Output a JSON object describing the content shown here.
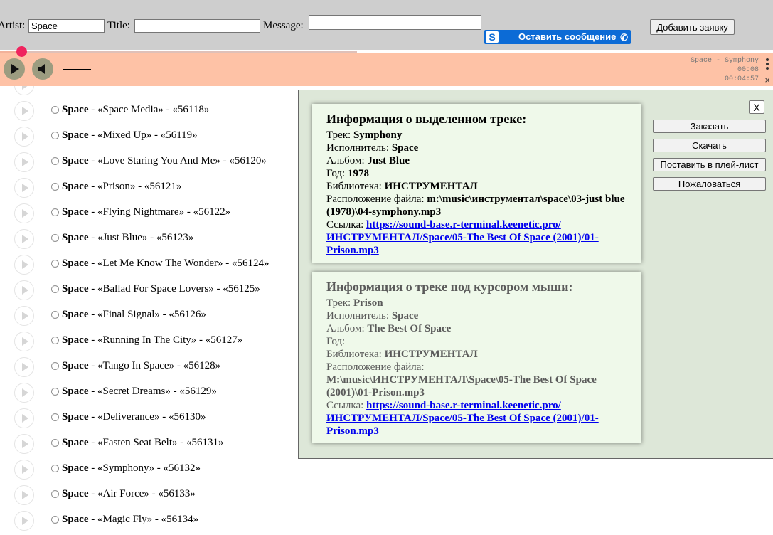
{
  "form": {
    "artist_label": "Artist:",
    "artist_value": "Space",
    "title_label": "Title:",
    "title_value": "",
    "message_label": "Message:",
    "message_value": "",
    "leave_message_label": "Оставить сообщение",
    "add_request_label": "Добавить заявку"
  },
  "player": {
    "progress_fraction": 0.06,
    "track_line": "Space - Symphony",
    "elapsed": "00:08",
    "duration": "00:04:57",
    "close_glyph": "×"
  },
  "tracks": [
    {
      "artist": "Space",
      "text": " - «Space Media» - «56118»"
    },
    {
      "artist": "Space",
      "text": " - «Mixed Up» - «56119»"
    },
    {
      "artist": "Space",
      "text": " - «Love Staring You And Me» - «56120»"
    },
    {
      "artist": "Space",
      "text": " - «Prison» - «56121»"
    },
    {
      "artist": "Space",
      "text": " - «Flying Nightmare» - «56122»"
    },
    {
      "artist": "Space",
      "text": " - «Just Blue» - «56123»"
    },
    {
      "artist": "Space",
      "text": " - «Let Me Know The Wonder» - «56124»"
    },
    {
      "artist": "Space",
      "text": " - «Ballad For Space Lovers» - «56125»"
    },
    {
      "artist": "Space",
      "text": " - «Final Signal» - «56126»"
    },
    {
      "artist": "Space",
      "text": " - «Running In The City» - «56127»"
    },
    {
      "artist": "Space",
      "text": " - «Tango In Space» - «56128»"
    },
    {
      "artist": "Space",
      "text": " - «Secret Dreams» - «56129»"
    },
    {
      "artist": "Space",
      "text": " - «Deliverance» - «56130»"
    },
    {
      "artist": "Space",
      "text": " - «Fasten Seat Belt» - «56131»"
    },
    {
      "artist": "Space",
      "text": " - «Symphony» - «56132»"
    },
    {
      "artist": "Space",
      "text": " - «Air Force» - «56133»"
    },
    {
      "artist": "Space",
      "text": " - «Magic Fly» - «56134»"
    }
  ],
  "selected": {
    "heading": "Информация о выделенном треке:",
    "track_label": "Трек: ",
    "track": "Symphony",
    "artist_label": "Исполнитель: ",
    "artist": "Space",
    "album_label": "Альбом: ",
    "album": "Just Blue",
    "year_label": "Год: ",
    "year": "1978",
    "library_label": "Библиотека: ",
    "library": "ИНСТРУМЕНТАЛ",
    "path_label": "Расположение файла: ",
    "path": "m:\\music\\инструментал\\space\\03-just blue (1978)\\04-symphony.mp3",
    "link_label": "Ссылка: ",
    "link": "https://sound-base.r-terminal.keenetic.pro/ИНСТРУМЕНТАЛ/Space/05-The Best Of Space (2001)/01-Prison.mp3"
  },
  "hover": {
    "heading": "Информация о треке под курсором мыши:",
    "track_label": "Трек: ",
    "track": "Prison",
    "artist_label": "Исполнитель: ",
    "artist": "Space",
    "album_label": "Альбом: ",
    "album": "The Best Of Space",
    "year_label": "Год: ",
    "year": "",
    "library_label": "Библиотека: ",
    "library": "ИНСТРУМЕНТАЛ",
    "path_label": "Расположение файла: ",
    "path": "M:\\music\\ИНСТРУМЕНТАЛ\\Space\\05-The Best Of Space (2001)\\01-Prison.mp3",
    "link_label": "Ссылка: ",
    "link": "https://sound-base.r-terminal.keenetic.pro/ИНСТРУМЕНТАЛ/Space/05-The Best Of Space (2001)/01-Prison.mp3"
  },
  "panel": {
    "close_label": "X",
    "order_label": "Заказать",
    "download_label": "Скачать",
    "playlist_label": "Поставить в плей-лист",
    "complain_label": "Пожаловаться"
  }
}
